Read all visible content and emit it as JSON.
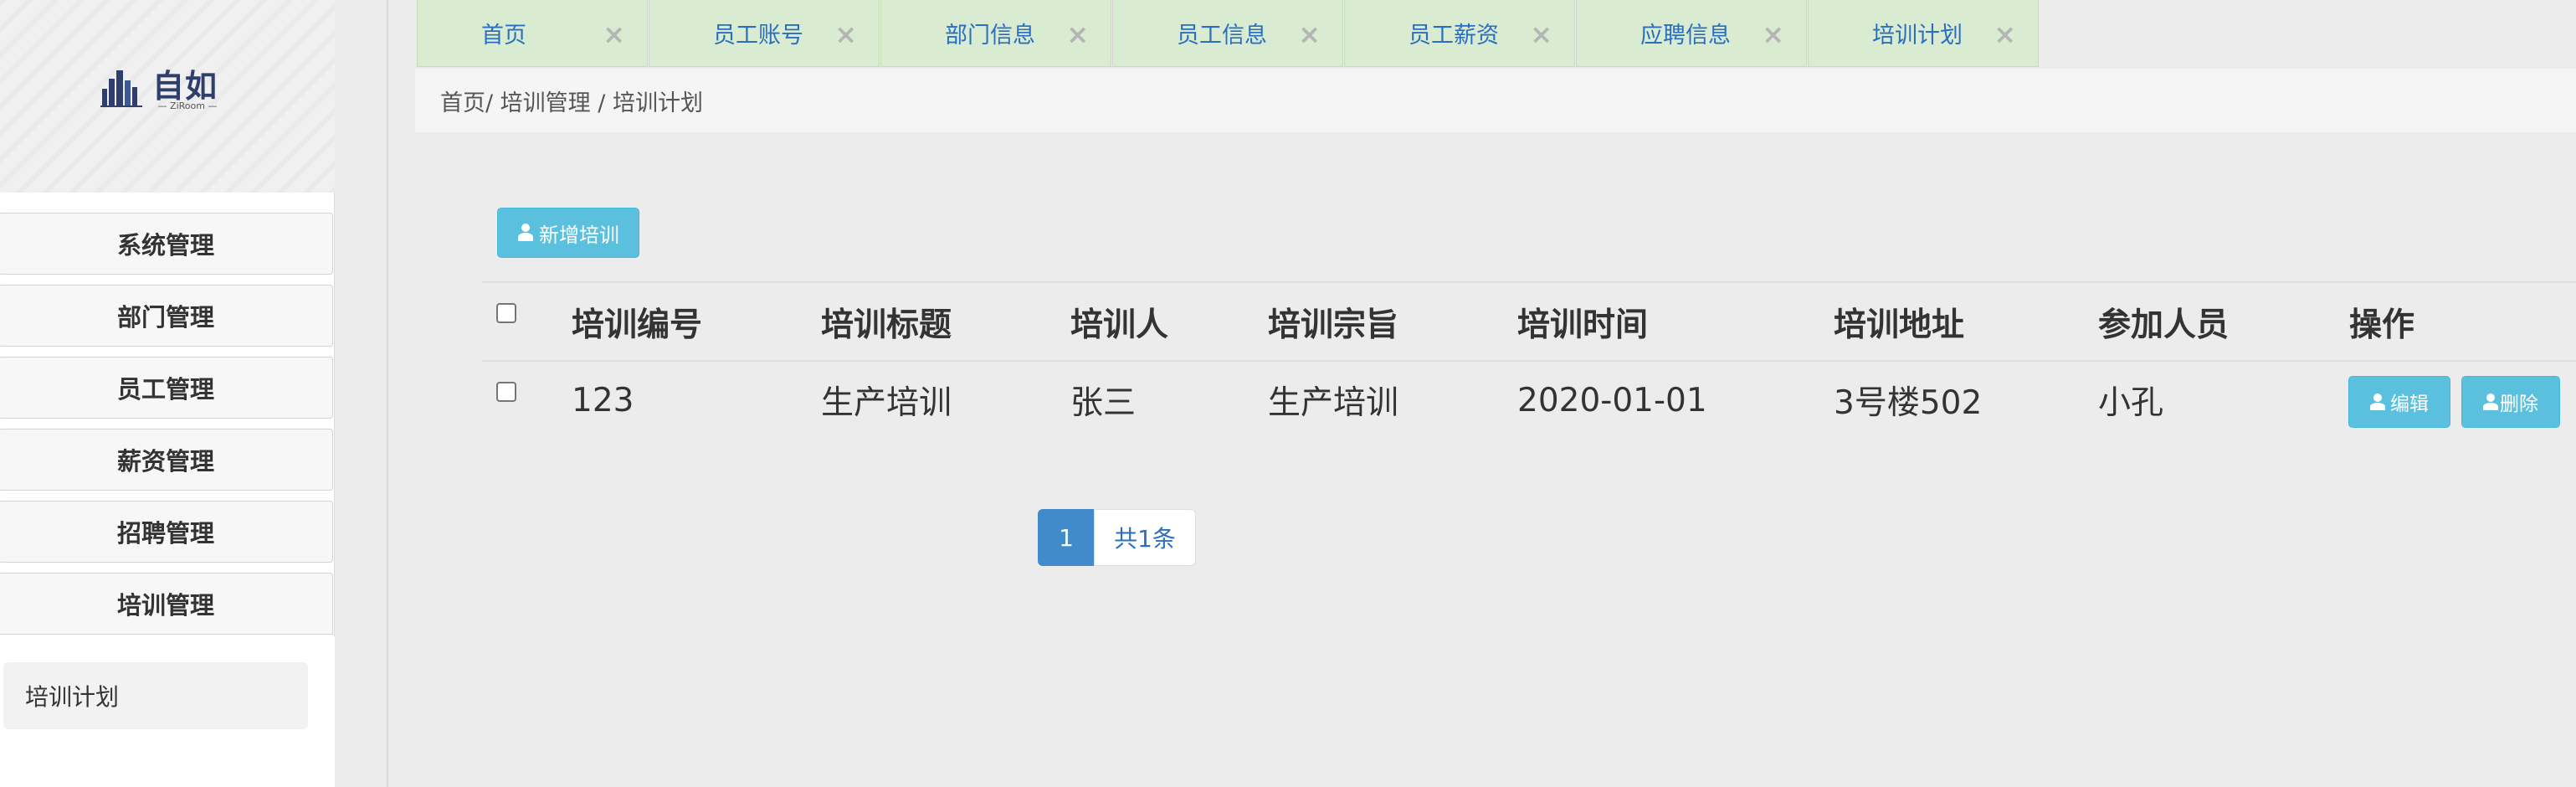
{
  "logo": {
    "name": "自如",
    "sub": "— ZiRoom —"
  },
  "tabs": [
    {
      "label": "首页",
      "close": "×"
    },
    {
      "label": "员工账号",
      "close": "×"
    },
    {
      "label": "部门信息",
      "close": "×"
    },
    {
      "label": "员工信息",
      "close": "×"
    },
    {
      "label": "员工薪资",
      "close": "×"
    },
    {
      "label": "应聘信息",
      "close": "×"
    },
    {
      "label": "培训计划",
      "close": "×"
    }
  ],
  "breadcrumb": "首页/ 培训管理 / 培训计划",
  "sidebar": {
    "menu": [
      {
        "label": "系统管理"
      },
      {
        "label": "部门管理"
      },
      {
        "label": "员工管理"
      },
      {
        "label": "薪资管理"
      },
      {
        "label": "招聘管理"
      },
      {
        "label": "培训管理"
      }
    ],
    "submenu": [
      {
        "label": "培训计划"
      }
    ]
  },
  "toolbar": {
    "add_label": "新增培训"
  },
  "table": {
    "headers": [
      "培训编号",
      "培训标题",
      "培训人",
      "培训宗旨",
      "培训时间",
      "培训地址",
      "参加人员",
      "操作"
    ],
    "rows": [
      {
        "cells": [
          "123",
          "生产培训",
          "张三",
          "生产培训",
          "2020-01-01",
          "3号楼502",
          "小孔"
        ],
        "edit_label": "编辑",
        "delete_label": "删除"
      }
    ]
  },
  "pagination": {
    "current": "1",
    "total": "共1条"
  },
  "colors": {
    "info_button": "#5bc0de",
    "primary": "#428bca",
    "tab_background": "#d9ecd2",
    "link": "#2a6fbf"
  },
  "icons": {
    "button_icon": "user-icon",
    "tab_close": "close-icon"
  }
}
